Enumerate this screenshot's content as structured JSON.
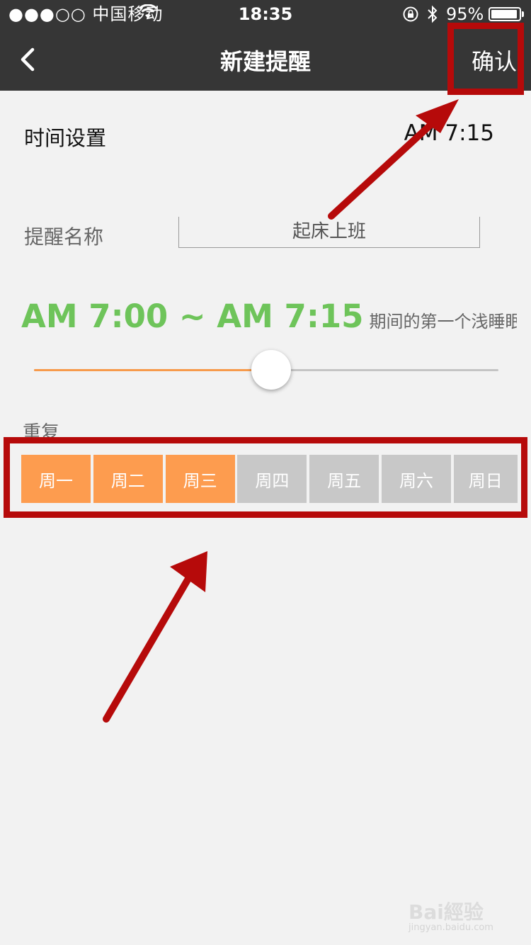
{
  "status_bar": {
    "signal": "●●●○○",
    "carrier": "中国移动",
    "time": "18:35",
    "battery": "95%",
    "battery_level": 0.95
  },
  "navbar": {
    "title": "新建提醒",
    "confirm_label": "确认"
  },
  "time_setting": {
    "label": "时间设置",
    "value": "AM 7:15"
  },
  "reminder_name": {
    "label": "提醒名称",
    "value": "起床上班"
  },
  "wake_range": {
    "range": "AM 7:00 ~ AM 7:15",
    "description": "期间的第一个浅睡眠中…",
    "slider_value": 0.51
  },
  "repeat": {
    "label": "重复",
    "days": [
      {
        "label": "周一",
        "selected": true
      },
      {
        "label": "周二",
        "selected": true
      },
      {
        "label": "周三",
        "selected": true
      },
      {
        "label": "周四",
        "selected": false
      },
      {
        "label": "周五",
        "selected": false
      },
      {
        "label": "周六",
        "selected": false
      },
      {
        "label": "周日",
        "selected": false
      }
    ]
  },
  "colors": {
    "topbar": "#363636",
    "accent_green": "#6ec45a",
    "active_day": "#fd9c4f",
    "inactive_day": "#c8c8c8",
    "annotation": "#b60a0a"
  },
  "icons": {
    "back": "chevron-left-icon",
    "wifi": "wifi-icon",
    "lock": "rotation-lock-icon",
    "bluetooth": "bluetooth-icon"
  },
  "watermark": {
    "logo": "Bai經验",
    "url": "jingyan.baidu.com"
  }
}
